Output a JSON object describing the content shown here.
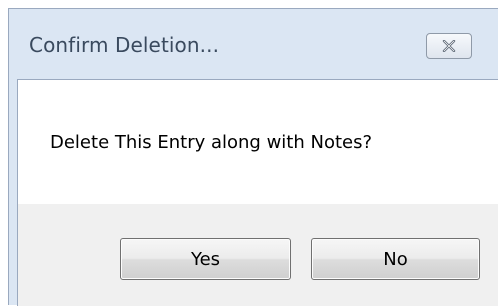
{
  "dialog": {
    "title": "Confirm Deletion...",
    "close_icon": "close-x-icon",
    "message": "Delete This Entry along with Notes?",
    "buttons": {
      "yes_label": "Yes",
      "no_label": "No"
    }
  }
}
